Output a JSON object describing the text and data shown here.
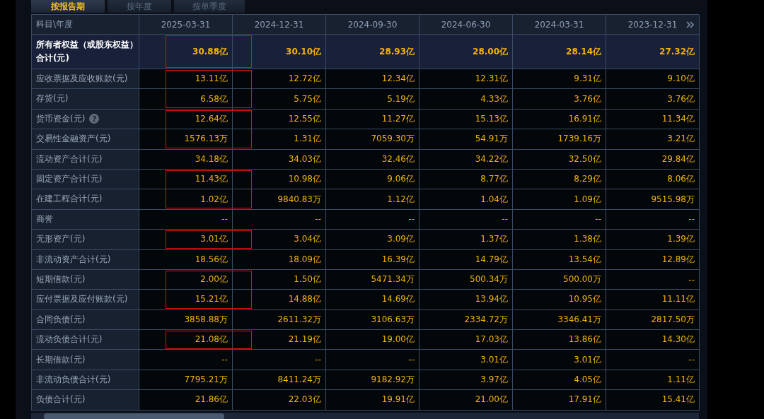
{
  "tabs": [
    {
      "label": "按报告期",
      "selected": true
    },
    {
      "label": "按年度",
      "selected": false
    },
    {
      "label": "按单季度",
      "selected": false
    }
  ],
  "table": {
    "corner": "科目\\年度",
    "columns": [
      "2025-03-31",
      "2024-12-31",
      "2024-09-30",
      "2024-06-30",
      "2024-03-31",
      "2023-12-31"
    ],
    "rows": [
      {
        "label": "所有者权益（或股东权益）合计(元)",
        "total": true,
        "kind": "boxed",
        "values": [
          "30.88亿",
          "30.10亿",
          "28.93亿",
          "28.00亿",
          "28.14亿",
          "27.32亿"
        ]
      },
      {
        "label": "应收票据及应收账款(元)",
        "total": false,
        "kind": "boxtop",
        "values": [
          "13.11亿",
          "12.72亿",
          "12.34亿",
          "12.31亿",
          "9.31亿",
          "9.10亿"
        ]
      },
      {
        "label": "存货(元)",
        "total": false,
        "kind": "boxbottom",
        "values": [
          "6.58亿",
          "5.75亿",
          "5.19亿",
          "4.33亿",
          "3.76亿",
          "3.76亿"
        ]
      },
      {
        "label": "货币资金(元)",
        "help_icon": "?",
        "total": false,
        "kind": "boxtop",
        "values": [
          "12.64亿",
          "12.55亿",
          "11.27亿",
          "15.13亿",
          "16.91亿",
          "11.34亿"
        ]
      },
      {
        "label": "交易性金融资产(元)",
        "total": false,
        "kind": "boxbottom",
        "values": [
          "1576.13万",
          "1.31亿",
          "7059.30万",
          "54.91万",
          "1739.16万",
          "3.21亿"
        ]
      },
      {
        "label": "流动资产合计(元)",
        "total": false,
        "kind": "plain",
        "values": [
          "34.18亿",
          "34.03亿",
          "32.46亿",
          "34.22亿",
          "32.50亿",
          "29.84亿"
        ]
      },
      {
        "label": "固定资产合计(元)",
        "total": false,
        "kind": "boxtop",
        "values": [
          "11.43亿",
          "10.98亿",
          "9.06亿",
          "8.77亿",
          "8.29亿",
          "8.06亿"
        ]
      },
      {
        "label": "在建工程合计(元)",
        "total": false,
        "kind": "boxbottom",
        "values": [
          "1.02亿",
          "9840.83万",
          "1.12亿",
          "1.04亿",
          "1.09亿",
          "9515.98万"
        ]
      },
      {
        "label": "商誉",
        "total": false,
        "kind": "plain",
        "values": [
          "--",
          "--",
          "--",
          "--",
          "--",
          "--"
        ]
      },
      {
        "label": "无形资产(元)",
        "total": false,
        "kind": "boxed",
        "values": [
          "3.01亿",
          "3.04亿",
          "3.09亿",
          "1.37亿",
          "1.38亿",
          "1.39亿"
        ]
      },
      {
        "label": "非流动资产合计(元)",
        "total": false,
        "kind": "plain",
        "values": [
          "18.56亿",
          "18.09亿",
          "16.39亿",
          "14.79亿",
          "13.54亿",
          "12.89亿"
        ]
      },
      {
        "label": "短期借款(元)",
        "total": false,
        "kind": "boxtop",
        "values": [
          "2.00亿",
          "1.50亿",
          "5471.34万",
          "500.34万",
          "500.00万",
          "--"
        ]
      },
      {
        "label": "应付票据及应付账款(元)",
        "total": false,
        "kind": "boxbottom",
        "values": [
          "15.21亿",
          "14.88亿",
          "14.69亿",
          "13.94亿",
          "10.95亿",
          "11.11亿"
        ]
      },
      {
        "label": "合同负债(元)",
        "total": false,
        "kind": "plain",
        "values": [
          "3858.88万",
          "2611.32万",
          "3106.63万",
          "2334.72万",
          "3346.41万",
          "2817.50万"
        ]
      },
      {
        "label": "流动负债合计(元)",
        "total": false,
        "kind": "boxed",
        "values": [
          "21.08亿",
          "21.19亿",
          "19.00亿",
          "17.03亿",
          "13.86亿",
          "14.30亿"
        ]
      },
      {
        "label": "长期借款(元)",
        "total": false,
        "kind": "plain",
        "values": [
          "--",
          "--",
          "--",
          "3.01亿",
          "3.01亿",
          "--"
        ]
      },
      {
        "label": "非流动负债合计(元)",
        "total": false,
        "kind": "plain",
        "values": [
          "7795.21万",
          "8411.24万",
          "9182.92万",
          "3.97亿",
          "4.05亿",
          "1.11亿"
        ]
      },
      {
        "label": "负债合计(元)",
        "total": false,
        "kind": "plain",
        "values": [
          "21.86亿",
          "22.03亿",
          "19.91亿",
          "21.00亿",
          "17.91亿",
          "15.41亿"
        ]
      }
    ]
  }
}
